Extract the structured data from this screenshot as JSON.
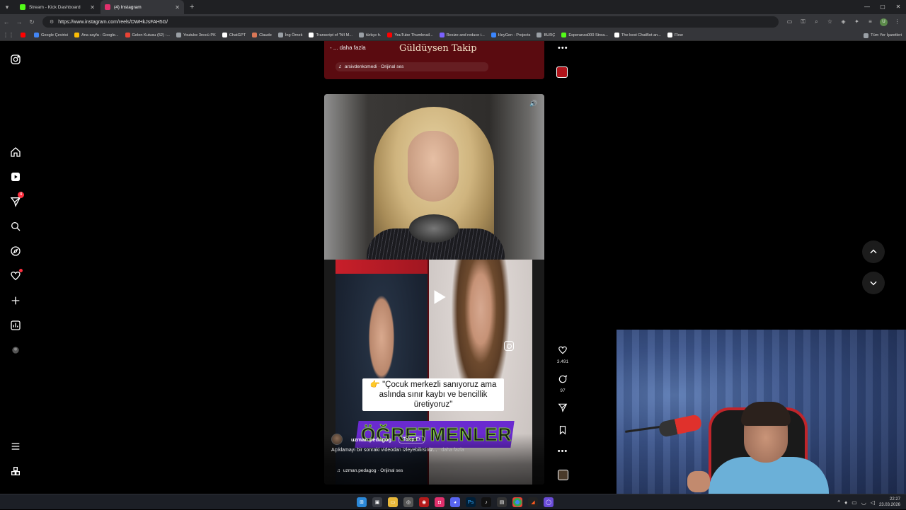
{
  "browser": {
    "tabs": [
      {
        "title": "Stream - Kick Dashboard",
        "active": false,
        "favicon_color": "#53fc18"
      },
      {
        "title": "(4) Instagram",
        "active": true,
        "favicon_color": "#e1306c"
      }
    ],
    "url": "https://www.instagram.com/reels/DWHkJsFAH5G/",
    "bookmarks": [
      {
        "label": "Google Çevirisi",
        "color": "#4285f4"
      },
      {
        "label": "Ana sayfa - Google...",
        "color": "#fbbc05"
      },
      {
        "label": "Gelen Kutusu (52) -...",
        "color": "#ea4335"
      },
      {
        "label": "Youtube 3nccü PK",
        "color": "#9aa0a6"
      },
      {
        "label": "ChatGPT",
        "color": "#ffffff"
      },
      {
        "label": "Claude",
        "color": "#d97757"
      },
      {
        "label": "İng Örnek",
        "color": "#9aa0a6"
      },
      {
        "label": "Transcript of \"MI M...",
        "color": "#ffffff"
      },
      {
        "label": "türkçe h.",
        "color": "#9aa0a6"
      },
      {
        "label": "YouTube Thumbnail...",
        "color": "#ff0000"
      },
      {
        "label": "Resize and reduce i...",
        "color": "#7b61ff"
      },
      {
        "label": "HeyGen - Projects",
        "color": "#3a86ff"
      },
      {
        "label": "BURÇ",
        "color": "#9aa0a6"
      },
      {
        "label": "Esperanza000 Strea...",
        "color": "#53fc18"
      },
      {
        "label": "The best ChatBot an...",
        "color": "#ffffff"
      },
      {
        "label": "Flow",
        "color": "#ffffff"
      }
    ],
    "bookmarks_right": "Tüm Yer İşaretleri"
  },
  "prev_reel": {
    "more_text": "- ... daha fazla",
    "title_overlay": "Güldüysen Takip",
    "audio": "arsivdenkomedi · Orijinal ses"
  },
  "reel": {
    "quote": "👉 \"Çocuk merkezli sanıyoruz ama aslında sınır kaybı ve bencillik üretiyoruz\"",
    "banner": "ÖĞRETMENLER",
    "author": "uzman.pedagog",
    "follow_label": "Takip Et",
    "caption": "Açıklamayı bir sonraki videodan izleyebilirsiniz...",
    "caption_more": "daha fazla",
    "audio": "uzman.pedagog · Orijinal ses",
    "likes": "3.491",
    "comments": "97"
  },
  "sidebar": {
    "notification_count": "4"
  },
  "taskbar": {
    "time": "22:27",
    "date": "23.03.2026"
  },
  "colors": {
    "accent": "#ff3040",
    "page_bg": "#000000"
  }
}
